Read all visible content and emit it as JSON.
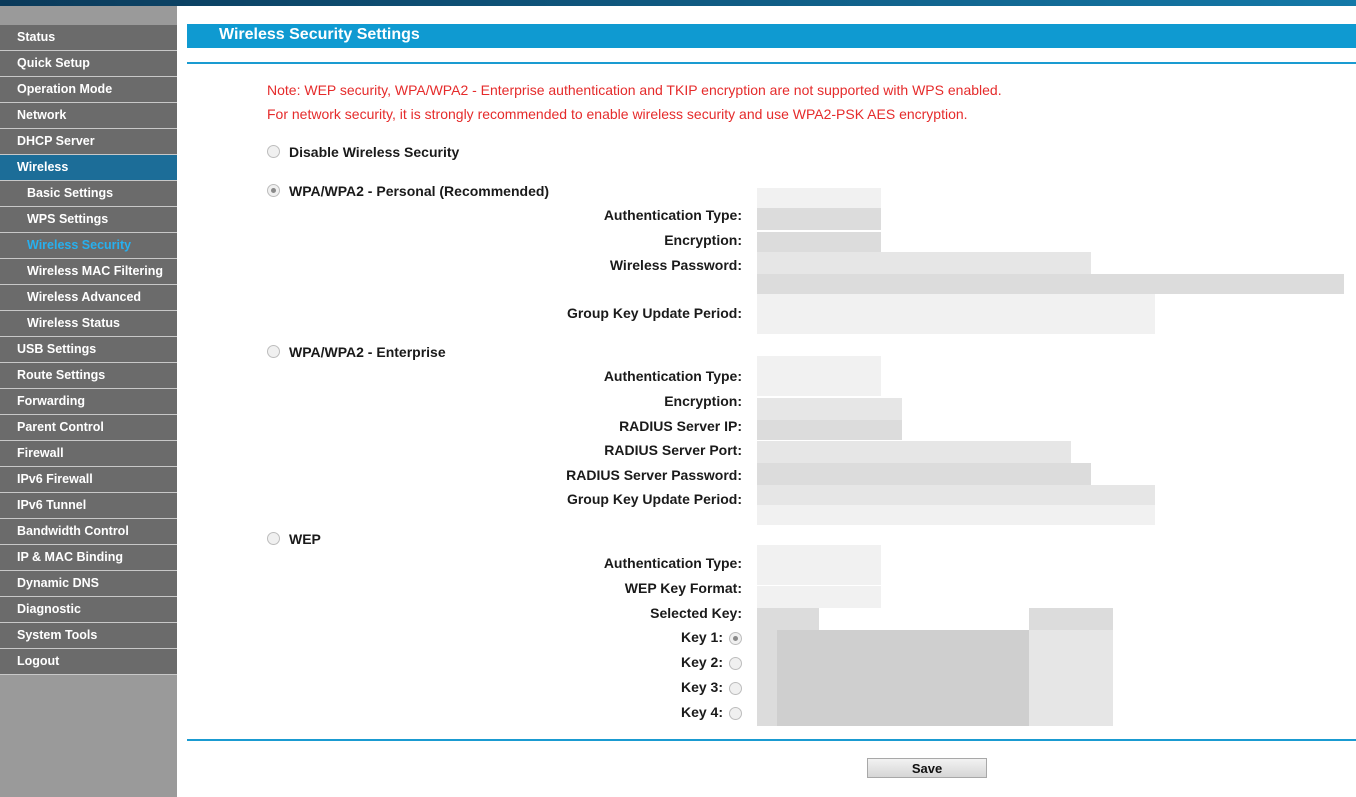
{
  "sidebar": {
    "items": [
      {
        "label": "Status"
      },
      {
        "label": "Quick Setup"
      },
      {
        "label": "Operation Mode"
      },
      {
        "label": "Network"
      },
      {
        "label": "DHCP Server"
      },
      {
        "label": "Wireless"
      },
      {
        "label": "Basic Settings"
      },
      {
        "label": "WPS Settings"
      },
      {
        "label": "Wireless Security"
      },
      {
        "label": "Wireless MAC Filtering"
      },
      {
        "label": "Wireless Advanced"
      },
      {
        "label": "Wireless Status"
      },
      {
        "label": "USB Settings"
      },
      {
        "label": "Route Settings"
      },
      {
        "label": "Forwarding"
      },
      {
        "label": "Parent Control"
      },
      {
        "label": "Firewall"
      },
      {
        "label": "IPv6 Firewall"
      },
      {
        "label": "IPv6 Tunnel"
      },
      {
        "label": "Bandwidth Control"
      },
      {
        "label": "IP & MAC Binding"
      },
      {
        "label": "Dynamic DNS"
      },
      {
        "label": "Diagnostic"
      },
      {
        "label": "System Tools"
      },
      {
        "label": "Logout"
      }
    ]
  },
  "page": {
    "title": "Wireless Security Settings",
    "note1": "Note: WEP security, WPA/WPA2 - Enterprise authentication and TKIP encryption are not supported with WPS enabled.",
    "note2": "For network security, it is strongly recommended to enable wireless security and use WPA2-PSK AES encryption."
  },
  "options": {
    "disable": {
      "label": "Disable Wireless Security"
    },
    "personal": {
      "label": "WPA/WPA2 - Personal (Recommended)",
      "auth_type": "Authentication Type:",
      "encryption": "Encryption:",
      "password": "Wireless Password:",
      "group_key": "Group Key Update Period:"
    },
    "enterprise": {
      "label": "WPA/WPA2 - Enterprise",
      "auth_type": "Authentication Type:",
      "encryption": "Encryption:",
      "radius_ip": "RADIUS Server IP:",
      "radius_port": "RADIUS Server Port:",
      "radius_password": "RADIUS Server Password:",
      "group_key": "Group Key Update Period:"
    },
    "wep": {
      "label": "WEP",
      "auth_type": "Authentication Type:",
      "key_format": "WEP Key Format:",
      "selected_key": "Selected Key:",
      "key1": "Key 1:",
      "key2": "Key 2:",
      "key3": "Key 3:",
      "key4": "Key 4:"
    }
  },
  "actions": {
    "save": "Save"
  },
  "colors": {
    "accent": "#0f9ad1",
    "note": "#e52b2b",
    "menu_active": "#1c6d98",
    "menu_current_text": "#27b0ef"
  }
}
